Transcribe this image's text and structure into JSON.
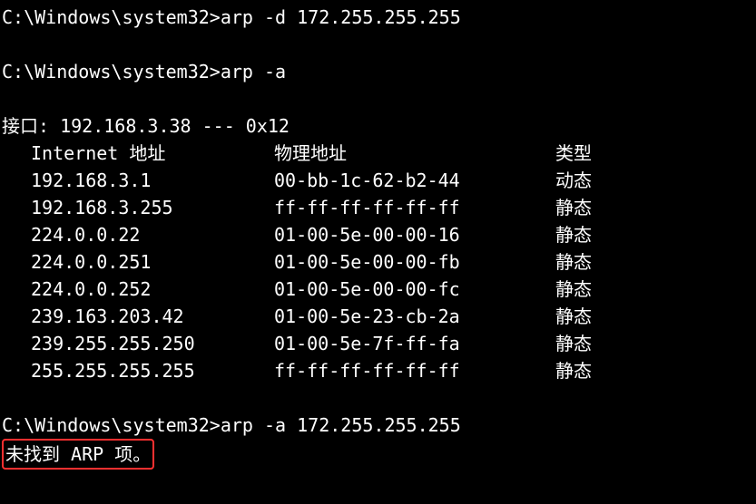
{
  "prompt": "C:\\Windows\\system32>",
  "commands": {
    "cmd1": "arp -d 172.255.255.255",
    "cmd2": "arp -a",
    "cmd3": "arp -a 172.255.255.255"
  },
  "interface_line": "接口: 192.168.3.38 --- 0x12",
  "headers": {
    "ip": "Internet 地址",
    "mac": "物理地址",
    "type": "类型"
  },
  "entries": [
    {
      "ip": "192.168.3.1",
      "mac": "00-bb-1c-62-b2-44",
      "type": "动态"
    },
    {
      "ip": "192.168.3.255",
      "mac": "ff-ff-ff-ff-ff-ff",
      "type": "静态"
    },
    {
      "ip": "224.0.0.22",
      "mac": "01-00-5e-00-00-16",
      "type": "静态"
    },
    {
      "ip": "224.0.0.251",
      "mac": "01-00-5e-00-00-fb",
      "type": "静态"
    },
    {
      "ip": "224.0.0.252",
      "mac": "01-00-5e-00-00-fc",
      "type": "静态"
    },
    {
      "ip": "239.163.203.42",
      "mac": "01-00-5e-23-cb-2a",
      "type": "静态"
    },
    {
      "ip": "239.255.255.250",
      "mac": "01-00-5e-7f-ff-fa",
      "type": "静态"
    },
    {
      "ip": "255.255.255.255",
      "mac": "ff-ff-ff-ff-ff-ff",
      "type": "静态"
    }
  ],
  "not_found": "未找到 ARP 项。"
}
